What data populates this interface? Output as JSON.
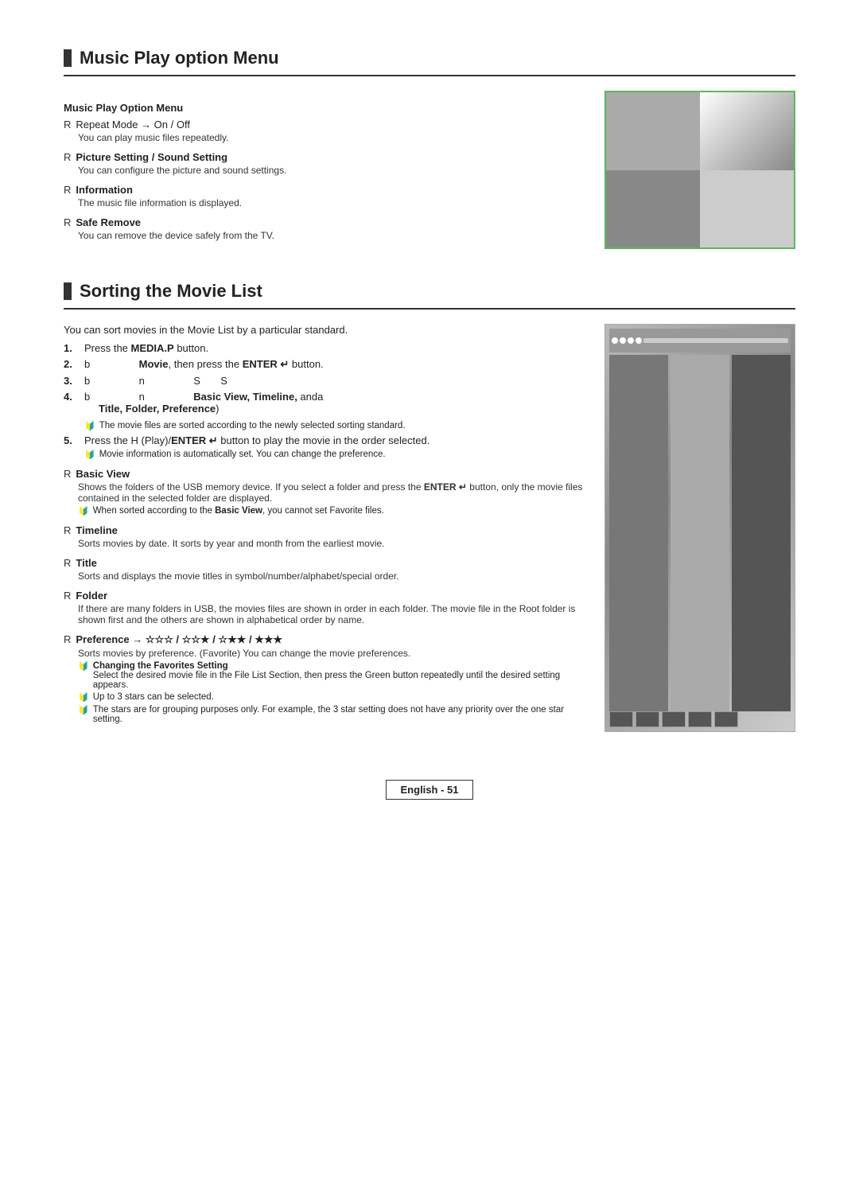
{
  "page": {
    "section1": {
      "title": "Music Play option Menu",
      "sub_heading": "Music Play Option Menu",
      "items": [
        {
          "label": "Repeat Mode → On / Off",
          "desc": "You can play music files repeatedly.",
          "bold": false
        },
        {
          "label": "Picture Setting / Sound Setting",
          "desc": "You can configure the picture and sound settings.",
          "bold": true
        },
        {
          "label": "Information",
          "desc": "The music file information is displayed.",
          "bold": true
        },
        {
          "label": "Safe Remove",
          "desc": "You can remove the device safely from the TV.",
          "bold": true
        }
      ]
    },
    "section2": {
      "title": "Sorting the Movie List",
      "intro": "You can sort movies in the Movie List by a particular standard.",
      "steps": [
        {
          "num": "1.",
          "text": "Press the ",
          "bold_part": "MEDIA.P",
          "text2": " button."
        },
        {
          "num": "2.",
          "text": "b",
          "text2": "",
          "mid": "Movie",
          "end": ", then press the ",
          "bold_end": "ENTER",
          "after": " button."
        },
        {
          "num": "3.",
          "text": "b",
          "text2": "n",
          "mid_s": "S",
          "mid_s2": "S"
        },
        {
          "num": "4.",
          "text": "b",
          "text2": "n",
          "bold_label": "Basic View, Timeline,",
          "anda": "anda",
          "sub": "Title, Folder, Preference)"
        }
      ],
      "step5": "Press the  H  (Play)/ENTER    button to play the movie in the order selected.",
      "note5": "Movie information is automatically set. You can change the preference.",
      "items": [
        {
          "label": "Basic View",
          "desc": "Shows the folders of the USB memory device. If you select a folder and press the ENTER    button, only the movie files contained in the selected folder are displayed.",
          "note": "When sorted according to the Basic View, you cannot set Favorite files.",
          "bold": true
        },
        {
          "label": "Timeline",
          "desc": "Sorts movies by date. It sorts by year and month from the earliest movie.",
          "bold": true
        },
        {
          "label": "Title",
          "desc": "Sorts and displays the movie titles in symbol/number/alphabet/special order.",
          "bold": true
        },
        {
          "label": "Folder",
          "desc": "If there are many folders in USB, the movies files are shown in order in each folder. The movie file in the Root folder is shown first and the others are shown in alphabetical order by name.",
          "bold": true
        },
        {
          "label": "Preference → ☆☆☆ / ☆☆★ / ☆★★ / ★★★",
          "desc": "Sorts movies by preference. (Favorite) You can change the movie preferences.",
          "bold": true,
          "notes": [
            {
              "sub_label": "Changing the Favorites Setting",
              "desc": "Select the desired movie file in the File List Section, then press the Green button repeatedly until the desired setting appears."
            },
            {
              "sub_label": "",
              "desc": "Up to 3 stars can be selected."
            },
            {
              "sub_label": "",
              "desc": "The stars are for grouping purposes only. For example, the 3 star setting does not have any priority over the one star setting."
            }
          ]
        }
      ]
    },
    "footer": {
      "label": "English - 51"
    }
  }
}
